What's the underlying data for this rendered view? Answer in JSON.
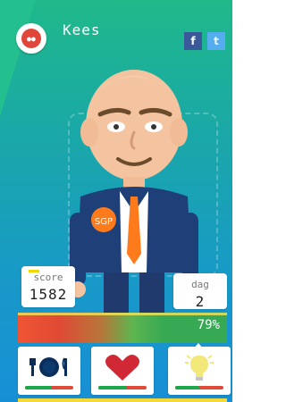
{
  "header": {
    "name": "Kees"
  },
  "social": {
    "facebook": "f",
    "twitter": "t"
  },
  "stats": {
    "score_label": "score",
    "score_value": "1582",
    "day_label": "dag",
    "day_value": "2"
  },
  "progress": {
    "label": "79%",
    "value": 0.79
  },
  "needs": [
    {
      "name": "food",
      "level": 0.55
    },
    {
      "name": "love",
      "level": 0.6
    },
    {
      "name": "idea",
      "level": 0.5
    }
  ],
  "character": {
    "badge": "SGP"
  },
  "colors": {
    "green": "#1fb98a",
    "blue": "#178fd6",
    "red": "#e0463a",
    "progress_good": "#37a955"
  }
}
